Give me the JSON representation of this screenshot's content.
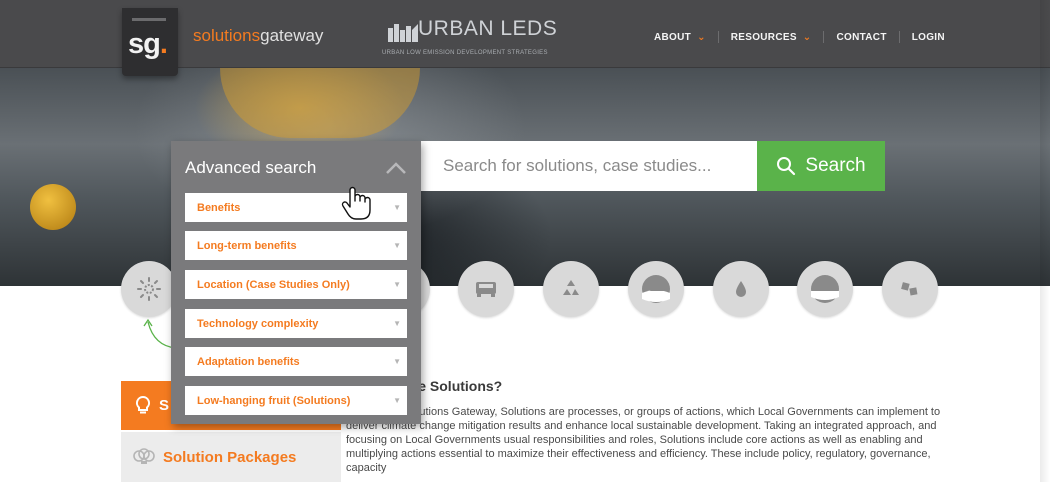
{
  "header": {
    "logo": {
      "mark": "sg",
      "dot": "."
    },
    "brand": {
      "part1": "solutions",
      "part2": "gateway"
    },
    "partner": {
      "title": "URBAN LEDS",
      "subtitle": "URBAN LOW EMISSION DEVELOPMENT STRATEGIES"
    },
    "nav": [
      {
        "label": "ABOUT",
        "dropdown": true
      },
      {
        "label": "RESOURCES",
        "dropdown": true
      },
      {
        "label": "CONTACT",
        "dropdown": false
      },
      {
        "label": "LOGIN",
        "dropdown": false
      }
    ]
  },
  "search": {
    "placeholder": "Search for solutions, case studies...",
    "button_label": "Search"
  },
  "advanced_search": {
    "title": "Advanced search",
    "filters": [
      "Benefits",
      "Long-term benefits",
      "Location (Case Studies Only)",
      "Technology complexity",
      "Adaptation benefits",
      "Low-hanging fruit (Solutions)"
    ]
  },
  "categories": [
    {
      "icon": "sun-icon"
    },
    {
      "icon": "building-icon"
    },
    {
      "icon": "lightbulb-icon"
    },
    {
      "icon": "car-icon"
    },
    {
      "icon": "recycle-icon"
    },
    {
      "icon": "island-icon"
    },
    {
      "icon": "water-drop-icon"
    },
    {
      "icon": "landscape-icon"
    },
    {
      "icon": "puzzle-icon"
    }
  ],
  "sidebar": {
    "solutions_label": "S",
    "packages_label": "Solution Packages"
  },
  "content": {
    "title": "are Solutions?",
    "body": "ntext of the Solutions Gateway, Solutions are processes, or groups of actions, which Local Governments can implement to deliver climate change mitigation results and enhance local sustainable development. Taking an integrated approach, and focusing on Local Governments usual responsibilities and roles, Solutions include core actions as well as enabling and multiplying actions essential to maximize their effectiveness and efficiency. These include policy, regulatory, governance, capacity"
  },
  "colors": {
    "accent": "#f47b20",
    "search_green": "#5ab34a",
    "header": "#4a4a4c",
    "panel": "#7a7a7c"
  }
}
